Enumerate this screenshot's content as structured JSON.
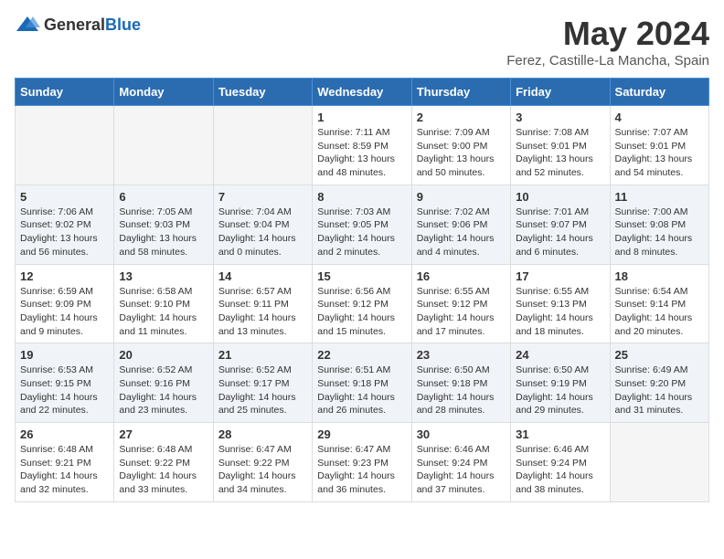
{
  "logo": {
    "general": "General",
    "blue": "Blue"
  },
  "header": {
    "month": "May 2024",
    "location": "Ferez, Castille-La Mancha, Spain"
  },
  "weekdays": [
    "Sunday",
    "Monday",
    "Tuesday",
    "Wednesday",
    "Thursday",
    "Friday",
    "Saturday"
  ],
  "weeks": [
    [
      {
        "day": "",
        "info": ""
      },
      {
        "day": "",
        "info": ""
      },
      {
        "day": "",
        "info": ""
      },
      {
        "day": "1",
        "info": "Sunrise: 7:11 AM\nSunset: 8:59 PM\nDaylight: 13 hours and 48 minutes."
      },
      {
        "day": "2",
        "info": "Sunrise: 7:09 AM\nSunset: 9:00 PM\nDaylight: 13 hours and 50 minutes."
      },
      {
        "day": "3",
        "info": "Sunrise: 7:08 AM\nSunset: 9:01 PM\nDaylight: 13 hours and 52 minutes."
      },
      {
        "day": "4",
        "info": "Sunrise: 7:07 AM\nSunset: 9:01 PM\nDaylight: 13 hours and 54 minutes."
      }
    ],
    [
      {
        "day": "5",
        "info": "Sunrise: 7:06 AM\nSunset: 9:02 PM\nDaylight: 13 hours and 56 minutes."
      },
      {
        "day": "6",
        "info": "Sunrise: 7:05 AM\nSunset: 9:03 PM\nDaylight: 13 hours and 58 minutes."
      },
      {
        "day": "7",
        "info": "Sunrise: 7:04 AM\nSunset: 9:04 PM\nDaylight: 14 hours and 0 minutes."
      },
      {
        "day": "8",
        "info": "Sunrise: 7:03 AM\nSunset: 9:05 PM\nDaylight: 14 hours and 2 minutes."
      },
      {
        "day": "9",
        "info": "Sunrise: 7:02 AM\nSunset: 9:06 PM\nDaylight: 14 hours and 4 minutes."
      },
      {
        "day": "10",
        "info": "Sunrise: 7:01 AM\nSunset: 9:07 PM\nDaylight: 14 hours and 6 minutes."
      },
      {
        "day": "11",
        "info": "Sunrise: 7:00 AM\nSunset: 9:08 PM\nDaylight: 14 hours and 8 minutes."
      }
    ],
    [
      {
        "day": "12",
        "info": "Sunrise: 6:59 AM\nSunset: 9:09 PM\nDaylight: 14 hours and 9 minutes."
      },
      {
        "day": "13",
        "info": "Sunrise: 6:58 AM\nSunset: 9:10 PM\nDaylight: 14 hours and 11 minutes."
      },
      {
        "day": "14",
        "info": "Sunrise: 6:57 AM\nSunset: 9:11 PM\nDaylight: 14 hours and 13 minutes."
      },
      {
        "day": "15",
        "info": "Sunrise: 6:56 AM\nSunset: 9:12 PM\nDaylight: 14 hours and 15 minutes."
      },
      {
        "day": "16",
        "info": "Sunrise: 6:55 AM\nSunset: 9:12 PM\nDaylight: 14 hours and 17 minutes."
      },
      {
        "day": "17",
        "info": "Sunrise: 6:55 AM\nSunset: 9:13 PM\nDaylight: 14 hours and 18 minutes."
      },
      {
        "day": "18",
        "info": "Sunrise: 6:54 AM\nSunset: 9:14 PM\nDaylight: 14 hours and 20 minutes."
      }
    ],
    [
      {
        "day": "19",
        "info": "Sunrise: 6:53 AM\nSunset: 9:15 PM\nDaylight: 14 hours and 22 minutes."
      },
      {
        "day": "20",
        "info": "Sunrise: 6:52 AM\nSunset: 9:16 PM\nDaylight: 14 hours and 23 minutes."
      },
      {
        "day": "21",
        "info": "Sunrise: 6:52 AM\nSunset: 9:17 PM\nDaylight: 14 hours and 25 minutes."
      },
      {
        "day": "22",
        "info": "Sunrise: 6:51 AM\nSunset: 9:18 PM\nDaylight: 14 hours and 26 minutes."
      },
      {
        "day": "23",
        "info": "Sunrise: 6:50 AM\nSunset: 9:18 PM\nDaylight: 14 hours and 28 minutes."
      },
      {
        "day": "24",
        "info": "Sunrise: 6:50 AM\nSunset: 9:19 PM\nDaylight: 14 hours and 29 minutes."
      },
      {
        "day": "25",
        "info": "Sunrise: 6:49 AM\nSunset: 9:20 PM\nDaylight: 14 hours and 31 minutes."
      }
    ],
    [
      {
        "day": "26",
        "info": "Sunrise: 6:48 AM\nSunset: 9:21 PM\nDaylight: 14 hours and 32 minutes."
      },
      {
        "day": "27",
        "info": "Sunrise: 6:48 AM\nSunset: 9:22 PM\nDaylight: 14 hours and 33 minutes."
      },
      {
        "day": "28",
        "info": "Sunrise: 6:47 AM\nSunset: 9:22 PM\nDaylight: 14 hours and 34 minutes."
      },
      {
        "day": "29",
        "info": "Sunrise: 6:47 AM\nSunset: 9:23 PM\nDaylight: 14 hours and 36 minutes."
      },
      {
        "day": "30",
        "info": "Sunrise: 6:46 AM\nSunset: 9:24 PM\nDaylight: 14 hours and 37 minutes."
      },
      {
        "day": "31",
        "info": "Sunrise: 6:46 AM\nSunset: 9:24 PM\nDaylight: 14 hours and 38 minutes."
      },
      {
        "day": "",
        "info": ""
      }
    ]
  ]
}
